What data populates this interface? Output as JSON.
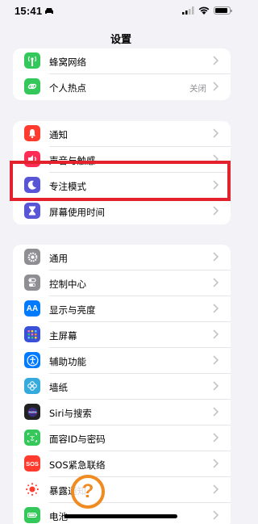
{
  "status_bar": {
    "time": "15:41",
    "battery_level": 0.9
  },
  "nav": {
    "title": "设置"
  },
  "groups": [
    {
      "rows": [
        {
          "label": "蜂窝网络",
          "icon": "antenna-icon",
          "icon_color": "#34c759"
        },
        {
          "label": "个人热点",
          "icon": "link-icon",
          "icon_color": "#34c759",
          "value": "关闭"
        }
      ]
    },
    {
      "rows": [
        {
          "label": "通知",
          "icon": "bell-icon",
          "icon_color": "#ff3b30"
        },
        {
          "label": "声音与触感",
          "icon": "speaker-icon",
          "icon_color": "#ff2d55"
        },
        {
          "label": "专注模式",
          "icon": "moon-icon",
          "icon_color": "#5856d6"
        },
        {
          "label": "屏幕使用时间",
          "icon": "hourglass-icon",
          "icon_color": "#5856d6"
        }
      ]
    },
    {
      "rows": [
        {
          "label": "通用",
          "icon": "gear-icon",
          "icon_color": "#8e8e93"
        },
        {
          "label": "控制中心",
          "icon": "toggles-icon",
          "icon_color": "#8e8e93"
        },
        {
          "label": "显示与亮度",
          "icon": "text-size-icon",
          "icon_color": "#007aff",
          "icon_text": "AA"
        },
        {
          "label": "主屏幕",
          "icon": "home-grid-icon",
          "icon_color": "#3a50d9"
        },
        {
          "label": "辅助功能",
          "icon": "accessibility-icon",
          "icon_color": "#007aff"
        },
        {
          "label": "墙纸",
          "icon": "flower-icon",
          "icon_color": "#35aadc"
        },
        {
          "label": "Siri与搜索",
          "icon": "siri-icon",
          "icon_color": "#222222"
        },
        {
          "label": "面容ID与密码",
          "icon": "face-id-icon",
          "icon_color": "#34c759"
        },
        {
          "label": "SOS紧急联络",
          "icon": "sos-icon",
          "icon_color": "#ff3b30",
          "icon_text": "SOS"
        },
        {
          "label": "暴露通知",
          "icon": "exposure-icon",
          "icon_color": "#ffffff"
        },
        {
          "label": "电池",
          "icon": "battery-icon",
          "icon_color": "#34c759"
        }
      ]
    }
  ],
  "overlay": {
    "help_badge": "?"
  }
}
